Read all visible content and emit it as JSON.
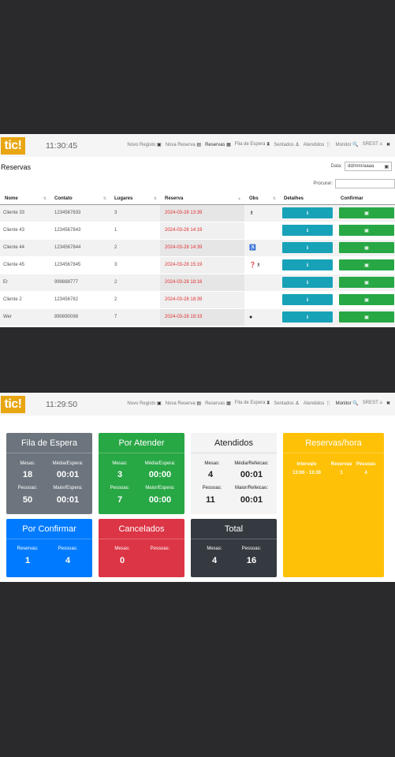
{
  "nav1": {
    "logo": "tic!",
    "clock": "11:30:45",
    "items": [
      {
        "label": "Novo Registo",
        "icon": "▣"
      },
      {
        "label": "Nova Reserva",
        "icon": "▤"
      },
      {
        "label": "Reservas",
        "icon": "▦",
        "active": true
      },
      {
        "label": "Fila de Espera",
        "icon": "⧗"
      },
      {
        "label": "Sentados",
        "icon": "♙"
      },
      {
        "label": "Atendidos",
        "icon": "🍴"
      },
      {
        "label": "Monitor",
        "icon": "🔍"
      },
      {
        "label": "SREST",
        "icon": "⌂"
      },
      {
        "label": "",
        "icon": "✖"
      }
    ]
  },
  "reservas": {
    "title": "Reservas",
    "date_label": "Data:",
    "date_placeholder": "dd/mm/aaaa",
    "search_label": "Procurar:",
    "columns": [
      "Nome",
      "Contato",
      "Lugares",
      "Reserva",
      "Obs",
      "Detalhes",
      "Confirmar"
    ],
    "rows": [
      {
        "nome": "Cliente 33",
        "contato": "1234567833",
        "lugares": "3",
        "reserva": "2024-03-28 13:39",
        "obs": "♗"
      },
      {
        "nome": "Cliente 43",
        "contato": "1234567843",
        "lugares": "1",
        "reserva": "2024-03-28 14:19",
        "obs": ""
      },
      {
        "nome": "Cliente 44",
        "contato": "1234567844",
        "lugares": "2",
        "reserva": "2024-03-28 14:39",
        "obs": "♿"
      },
      {
        "nome": "Cliente 45",
        "contato": "1234567845",
        "lugares": "3",
        "reserva": "2024-03-28 15:19",
        "obs": "❓♗"
      },
      {
        "nome": "Er",
        "contato": "999888777",
        "lugares": "2",
        "reserva": "2024-03-28 18:16",
        "obs": ""
      },
      {
        "nome": "Cliente 2",
        "contato": "123456782",
        "lugares": "2",
        "reserva": "2024-03-28 18:39",
        "obs": ""
      },
      {
        "nome": "Wer",
        "contato": "890890098",
        "lugares": "7",
        "reserva": "2024-03-28 19:19",
        "obs": "●"
      }
    ],
    "detail_icon": "ℹ",
    "confirm_icon": "▣"
  },
  "nav2": {
    "logo": "tic!",
    "clock": "11:29:50",
    "items": [
      {
        "label": "Novo Registo",
        "icon": "▣"
      },
      {
        "label": "Nova Reserva",
        "icon": "▤"
      },
      {
        "label": "Reservas",
        "icon": "▦"
      },
      {
        "label": "Fila de Espera",
        "icon": "⧗"
      },
      {
        "label": "Sentados",
        "icon": "♙"
      },
      {
        "label": "Atendidos",
        "icon": "🍴"
      },
      {
        "label": "Monitor",
        "icon": "🔍",
        "active": true
      },
      {
        "label": "SREST",
        "icon": "⌂"
      },
      {
        "label": "",
        "icon": "✖"
      }
    ]
  },
  "monitor": {
    "fila": {
      "title": "Fila de Espera",
      "l1": "Mesas:",
      "v1": "18",
      "l2": "Média/Espera:",
      "v2": "00:01",
      "l3": "Pessoas:",
      "v3": "50",
      "l4": "Maior/Espera:",
      "v4": "00:01"
    },
    "atender": {
      "title": "Por Atender",
      "l1": "Mesas:",
      "v1": "3",
      "l2": "Média/Espera:",
      "v2": "00:00",
      "l3": "Pessoas:",
      "v3": "7",
      "l4": "Maior/Espera:",
      "v4": "00:00"
    },
    "atendidos": {
      "title": "Atendidos",
      "l1": "Mesas:",
      "v1": "4",
      "l2": "Média/Refeicao:",
      "v2": "00:01",
      "l3": "Pessoas:",
      "v3": "11",
      "l4": "Maior/Refeicao:",
      "v4": "00:01"
    },
    "confirmar": {
      "title": "Por Confirmar",
      "l1": "Reservas:",
      "v1": "1",
      "l2": "Pessoas:",
      "v2": "4"
    },
    "cancelados": {
      "title": "Cancelados",
      "l1": "Mesas:",
      "v1": "0",
      "l2": "Pessoas:",
      "v2": ""
    },
    "total": {
      "title": "Total",
      "l1": "Mesas:",
      "v1": "4",
      "l2": "Pessoas:",
      "v2": "16"
    },
    "hora": {
      "title": "Reservas/hora",
      "h1": "Intervalo",
      "h2": "Reservas",
      "h3": "Pessoas",
      "c1": "13:00 - 13:30",
      "c2": "1",
      "c3": "4"
    }
  }
}
